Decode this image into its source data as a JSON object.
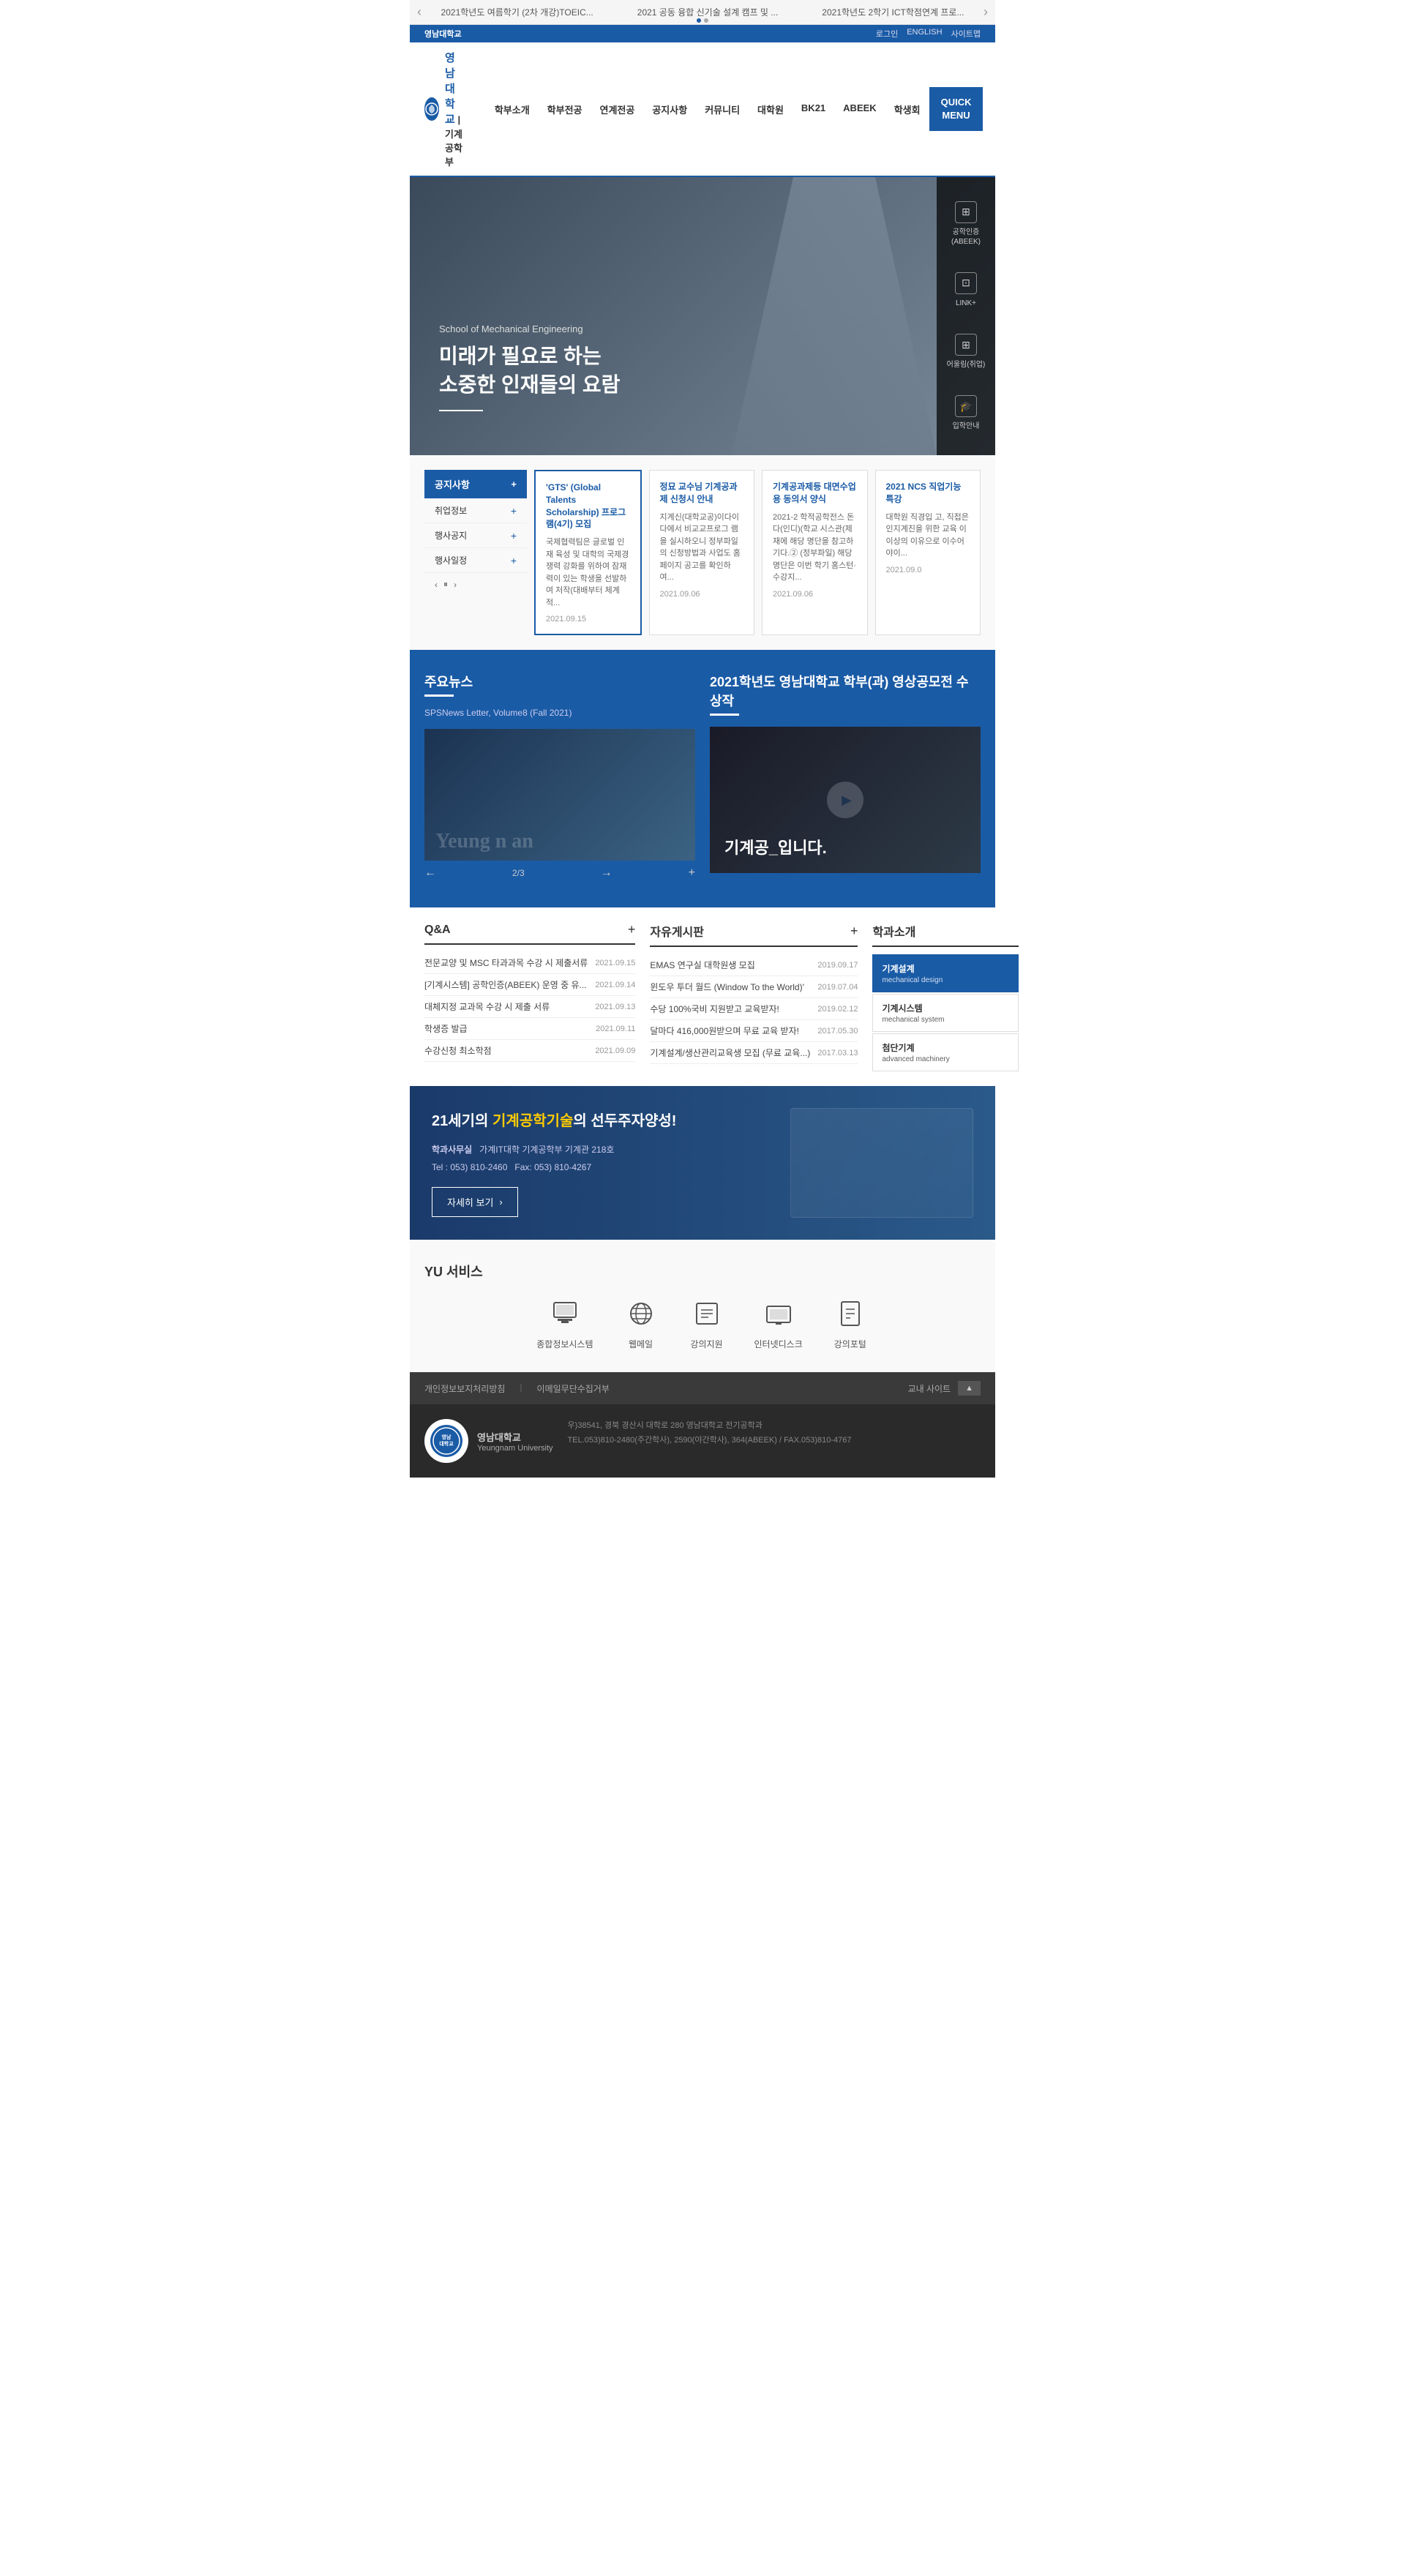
{
  "topBanner": {
    "items": [
      "2021학년도 여름학기 (2차 개강)TOEIC...",
      "2021 공동 융합 신기술 설계 캠프 및 ...",
      "2021학년도 2학기 ICT학점연계 프로..."
    ],
    "prevArrow": "‹",
    "nextArrow": "›"
  },
  "utilNav": {
    "universityLabel": "영남대학교",
    "links": [
      "로그인",
      "ENGLISH",
      "사이트맵"
    ]
  },
  "mainNav": {
    "logoText": "영남대학교",
    "deptText": "|기계공학부",
    "items": [
      "학부소개",
      "학부전공",
      "연계전공",
      "공지사항",
      "커뮤니티",
      "대학원",
      "BK21",
      "ABEEK",
      "학생회"
    ],
    "quickMenuLabel": "QUICK\nMENU"
  },
  "hero": {
    "subtitle": "School of Mechanical Engineering",
    "title": "미래가 필요로 하는\n소중한 인재들의 요람",
    "rightMenu": [
      {
        "label": "공학인증\n(ABEEK)",
        "icon": "🎓"
      },
      {
        "label": "LINK+",
        "icon": "🔗"
      },
      {
        "label": "어울림(취업)",
        "icon": "💼"
      },
      {
        "label": "입학안내",
        "icon": "🎒"
      }
    ]
  },
  "notice": {
    "tabLabel": "공지사항",
    "subTabs": [
      "취업정보",
      "행사공지",
      "행사일정"
    ],
    "cards": [
      {
        "title": "'GTS' (Global Talents Scholarship) 프로그램(4기) 모집",
        "body": "국제협력팀은 글로벌 인재 육성 및 대학의 국제경쟁력 강화를 위하여 잠재력이 있는 학생을 선발하여 저작(대배부터 체계적...",
        "date": "2021.09.15",
        "highlight": true
      },
      {
        "title": "정묘 교수님 기계공과제 신청시 안내",
        "body": "지계신(대학교공)이다이다에서 비교교프로그 램을 실시하오니 정부파일의 신청방법과 사업도 홈페이지 공고를 확인하여...",
        "date": "2021.09.06"
      },
      {
        "title": "기계공과제등 대면수업용 동의서 양식",
        "body": "2021-2 학적공학전스 돈다(인디)(학교 시스관(제재에 해당 명단을 참고하기다.② (정부파일) 해당 명단은 이번 학기 홈스턴·수강지...",
        "date": "2021.09.06"
      },
      {
        "title": "2021 NCS 직업기능 특강",
        "body": "대학원 직경입 고, 직접은 인지계진을 위한 교육 이 이상의 이유으로 이수어야이...",
        "date": "2021.09.0"
      }
    ]
  },
  "news": {
    "sectionTitle": "주요뉴스",
    "newsSubtitle": "SPSNews Letter, Volume8 (Fall 2021)",
    "counter": "2/3",
    "videoSectionTitle": "2021학년도 영남대학교 학부(과) 영상공모전 수상작",
    "videoOverlayText": "기계공_입니다.",
    "prevArrow": "←",
    "nextArrow": "→",
    "addBtn": "+"
  },
  "qna": {
    "title": "Q&A",
    "items": [
      {
        "text": "전문교양 및 MSC 타과과목 수강 시 제출서류",
        "date": "2021.09.15"
      },
      {
        "text": "[기계시스템] 공학인증(ABEEK) 운영 중 유...",
        "date": "2021.09.14"
      },
      {
        "text": "대체지정 교과목 수강 시 제출 서류",
        "date": "2021.09.13"
      },
      {
        "text": "학생증 발급",
        "date": "2021.09.11"
      },
      {
        "text": "수강신청 최소학점",
        "date": "2021.09.09"
      }
    ]
  },
  "board": {
    "title": "자유게시판",
    "items": [
      {
        "text": "EMAS 연구실 대학원생 모집",
        "date": "2019.09.17"
      },
      {
        "text": "윈도우 투더 월드 (Window To the World)'",
        "date": "2019.07.04"
      },
      {
        "text": "수당 100%국비 지원받고 교육받자!",
        "date": "2019.02.12"
      },
      {
        "text": "달마다 416,000원받으며 무료 교육 받자!",
        "date": "2017.05.30"
      },
      {
        "text": "기계설계/생산관리교육생 모집 (무료 교육...)",
        "date": "2017.03.13"
      }
    ]
  },
  "school": {
    "title": "학과소개",
    "tabs": [
      {
        "title": "기계설계",
        "sub": "mechanical design",
        "active": true
      },
      {
        "title": "기계시스템",
        "sub": "mechanical system",
        "active": false
      },
      {
        "title": "첨단기계",
        "sub": "advanced machinery",
        "active": false
      }
    ]
  },
  "footerBanner": {
    "title": "21세기의 기계공학기술의 선두주자양성!",
    "boldWord": "기계공학기술",
    "officeLabel": "학과사무실",
    "address": "가계IT대학 기계공학부 기계관 218호",
    "tel": "Tel : 053) 810-2460",
    "fax": "Fax: 053) 810-4267",
    "btnLabel": "자세히 보기",
    "btnArrow": "›"
  },
  "yuServices": {
    "title": "YU 서비스",
    "items": [
      {
        "label": "종합정보시스템",
        "icon": "🏛"
      },
      {
        "label": "웹메일",
        "icon": "🌐"
      },
      {
        "label": "강의지원",
        "icon": "📚"
      },
      {
        "label": "인터넷디스크",
        "icon": "🖥"
      },
      {
        "label": "강의포털",
        "icon": "📡"
      }
    ]
  },
  "footer": {
    "links": [
      "개인정보보지처리방침",
      "이메일무단수집거부"
    ],
    "campusLabel": "교내 사이트",
    "campusArrow": "▲",
    "univLogo": "영남\n대학교",
    "univName": "영남대학교",
    "univNameEn": "Yeungnam University",
    "address1": "우)38541, 경북 경산시 대학로 280 영남대학교 전기공학과",
    "address2": "TEL.053)810-2480(주간학사), 2590(야간학사), 364(ABEEK) / FAX.053)810-4767"
  },
  "colors": {
    "primary": "#1a5ba6",
    "accent": "#ffcc00",
    "darkBg": "#2c3e50",
    "cardBorder": "#1a5ba6"
  }
}
